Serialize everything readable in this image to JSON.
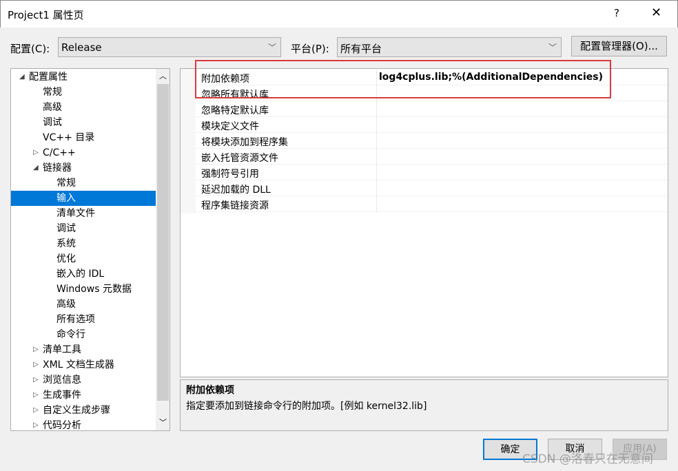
{
  "window": {
    "title": "Project1 属性页",
    "help": "?",
    "close": "✕"
  },
  "config": {
    "label": "配置(C):",
    "value": "Release",
    "platform_label": "平台(P):",
    "platform_value": "所有平台",
    "manager_button": "配置管理器(O)..."
  },
  "tree": {
    "items": [
      {
        "label": "配置属性",
        "level": 0,
        "expander": "expanded"
      },
      {
        "label": "常规",
        "level": 1
      },
      {
        "label": "高级",
        "level": 1
      },
      {
        "label": "调试",
        "level": 1
      },
      {
        "label": "VC++ 目录",
        "level": 1
      },
      {
        "label": "C/C++",
        "level": 1,
        "expander": "collapsed"
      },
      {
        "label": "链接器",
        "level": 1,
        "expander": "expanded"
      },
      {
        "label": "常规",
        "level": 2
      },
      {
        "label": "输入",
        "level": 2,
        "selected": true
      },
      {
        "label": "清单文件",
        "level": 2
      },
      {
        "label": "调试",
        "level": 2
      },
      {
        "label": "系统",
        "level": 2
      },
      {
        "label": "优化",
        "level": 2
      },
      {
        "label": "嵌入的 IDL",
        "level": 2
      },
      {
        "label": "Windows 元数据",
        "level": 2
      },
      {
        "label": "高级",
        "level": 2
      },
      {
        "label": "所有选项",
        "level": 2
      },
      {
        "label": "命令行",
        "level": 2
      },
      {
        "label": "清单工具",
        "level": 1,
        "expander": "collapsed"
      },
      {
        "label": "XML 文档生成器",
        "level": 1,
        "expander": "collapsed"
      },
      {
        "label": "浏览信息",
        "level": 1,
        "expander": "collapsed"
      },
      {
        "label": "生成事件",
        "level": 1,
        "expander": "collapsed"
      },
      {
        "label": "自定义生成步骤",
        "level": 1,
        "expander": "collapsed"
      },
      {
        "label": "代码分析",
        "level": 1,
        "expander": "collapsed"
      }
    ]
  },
  "grid": {
    "rows": [
      {
        "label": "附加依赖项",
        "value": "log4cplus.lib;%(AdditionalDependencies)"
      },
      {
        "label": "忽略所有默认库",
        "value": ""
      },
      {
        "label": "忽略特定默认库",
        "value": ""
      },
      {
        "label": "模块定义文件",
        "value": ""
      },
      {
        "label": "将模块添加到程序集",
        "value": ""
      },
      {
        "label": "嵌入托管资源文件",
        "value": ""
      },
      {
        "label": "强制符号引用",
        "value": ""
      },
      {
        "label": "延迟加载的 DLL",
        "value": ""
      },
      {
        "label": "程序集链接资源",
        "value": ""
      }
    ],
    "highlight_color": "#d9393c"
  },
  "description": {
    "title": "附加依赖项",
    "text": "指定要添加到链接命令行的附加项。[例如 kernel32.lib]"
  },
  "buttons": {
    "ok": "确定",
    "cancel": "取消",
    "apply": "应用(A)"
  },
  "watermark": "CSDN @洛春只在无意间",
  "colors": {
    "selection": "#0078d7",
    "highlight_box": "#d9393c"
  }
}
